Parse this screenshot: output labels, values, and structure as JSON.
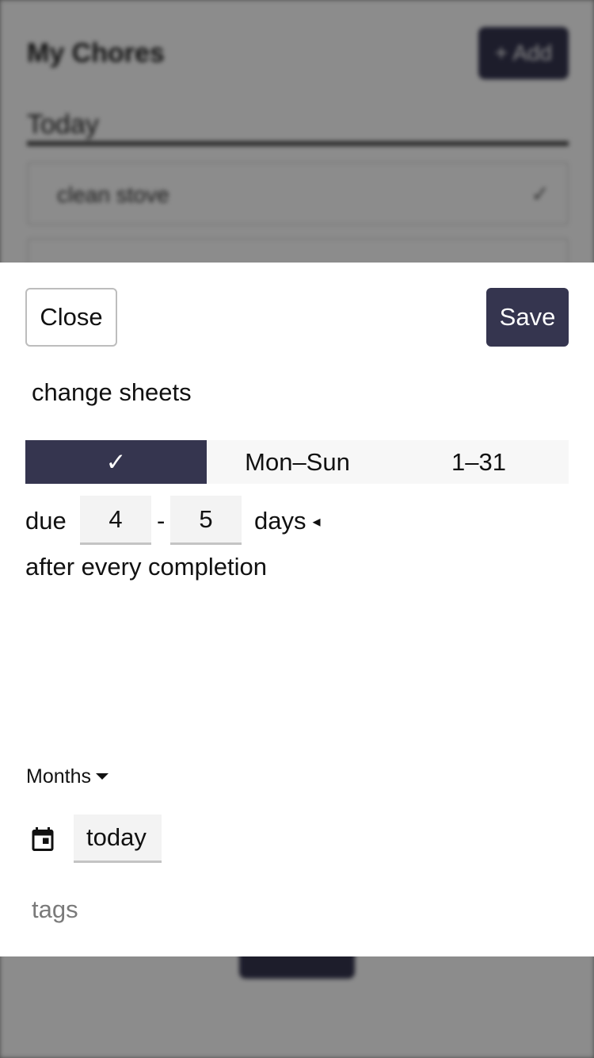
{
  "background": {
    "title": "My Chores",
    "add_button": "+ Add",
    "section": "Today",
    "rows": [
      {
        "label": "clean stove",
        "check": "✓"
      },
      {
        "label": "",
        "check": ""
      }
    ]
  },
  "sheet": {
    "close_label": "Close",
    "save_label": "Save",
    "chore_name": "change sheets",
    "schedule_options": [
      {
        "label": "✓",
        "active": true
      },
      {
        "label": "Mon–Sun",
        "active": false
      },
      {
        "label": "1–31",
        "active": false
      }
    ],
    "due_label": "due",
    "min_days": "4",
    "range_separator": "-",
    "max_days": "5",
    "unit_label": "days",
    "unit_arrow": "◂",
    "after_text": "after every completion",
    "months_label": "Months",
    "start_date": "today",
    "tags_placeholder": "tags"
  },
  "colors": {
    "accent": "#35354f",
    "overlay": "#8a8a8a"
  },
  "icons": {
    "calendar": "calendar-icon",
    "dropdown": "caret-down-icon"
  }
}
